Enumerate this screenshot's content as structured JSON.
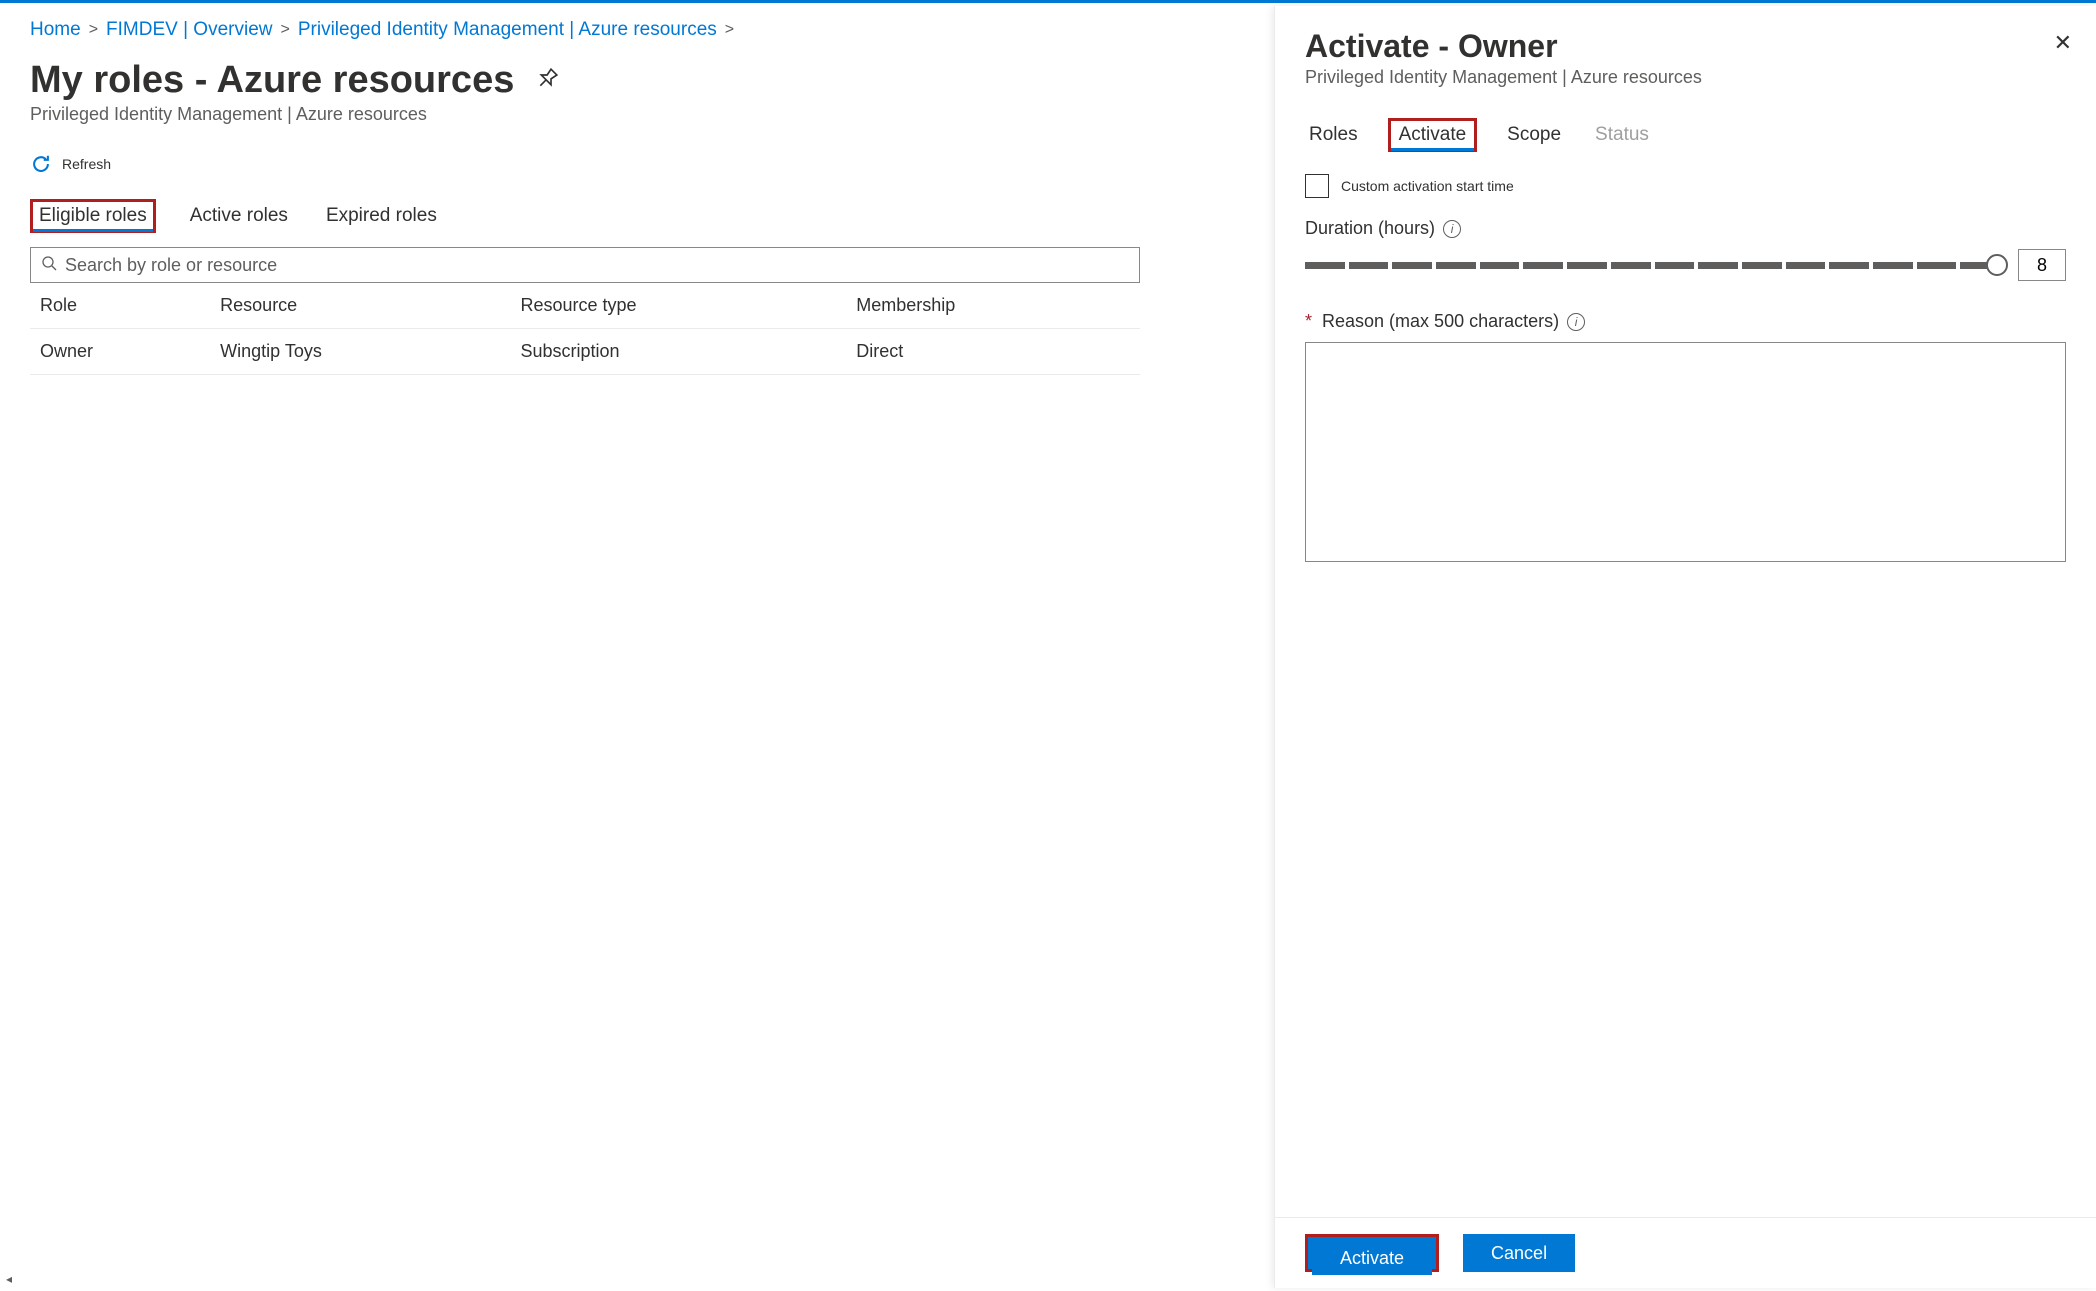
{
  "breadcrumb": {
    "items": [
      {
        "label": "Home"
      },
      {
        "label": "FIMDEV | Overview"
      },
      {
        "label": "Privileged Identity Management | Azure resources"
      }
    ]
  },
  "page": {
    "title": "My roles - Azure resources",
    "subtitle": "Privileged Identity Management | Azure resources"
  },
  "commands": {
    "refresh": "Refresh"
  },
  "tabs": [
    {
      "label": "Eligible roles",
      "active": true,
      "highlight": true
    },
    {
      "label": "Active roles"
    },
    {
      "label": "Expired roles"
    }
  ],
  "search": {
    "placeholder": "Search by role or resource"
  },
  "table": {
    "headers": [
      "Role",
      "Resource",
      "Resource type",
      "Membership"
    ],
    "rows": [
      {
        "role": "Owner",
        "resource": "Wingtip Toys",
        "resource_type": "Subscription",
        "membership": "Direct"
      }
    ]
  },
  "panel": {
    "title": "Activate - Owner",
    "subtitle": "Privileged Identity Management | Azure resources",
    "tabs": [
      {
        "label": "Roles"
      },
      {
        "label": "Activate",
        "active": true,
        "highlight": true
      },
      {
        "label": "Scope"
      },
      {
        "label": "Status",
        "disabled": true
      }
    ],
    "custom_start": {
      "label": "Custom activation start time",
      "checked": false
    },
    "duration": {
      "label": "Duration (hours)",
      "value": "8",
      "segments": 16
    },
    "reason": {
      "label": "Reason (max 500 characters)",
      "required": true,
      "value": ""
    },
    "buttons": {
      "activate": "Activate",
      "cancel": "Cancel"
    }
  }
}
